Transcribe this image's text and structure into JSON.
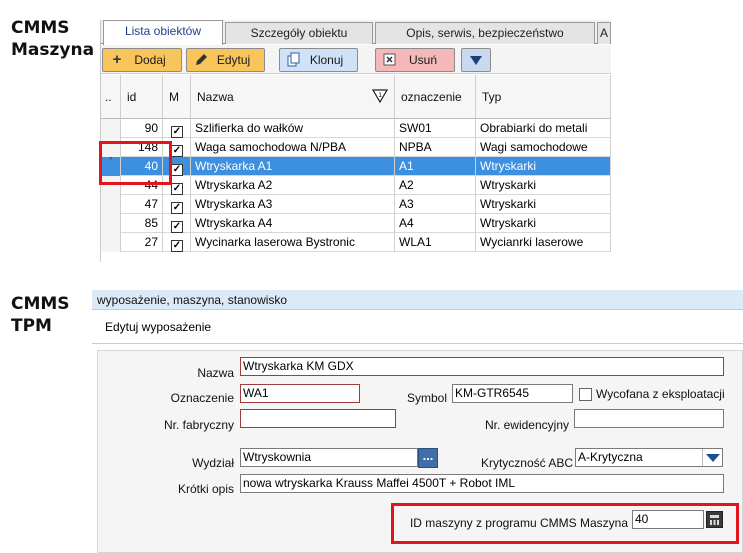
{
  "labels": {
    "cmms_line1": "CMMS",
    "cmms_line2": "Maszyna",
    "tpm_line1": "CMMS",
    "tpm_line2": "TPM"
  },
  "tabs": [
    {
      "label": "Lista obiektów",
      "active": true
    },
    {
      "label": "Szczegóły obiektu",
      "active": false
    },
    {
      "label": "Opis, serwis, bezpieczeństwo",
      "active": false
    },
    {
      "label": "A",
      "active": false
    }
  ],
  "toolbar": {
    "add_label": "Dodaj",
    "edit_label": "Edytuj",
    "clone_label": "Klonuj",
    "delete_label": "Usuń"
  },
  "grid": {
    "columns": [
      "..",
      "id",
      "M",
      "Nazwa",
      "oznaczenie",
      "Typ"
    ],
    "rows": [
      {
        "id": "90",
        "checked": true,
        "name": "Szlifierka do wałków",
        "code": "SW01",
        "type": "Obrabiarki do metali",
        "selected": false
      },
      {
        "id": "148",
        "checked": true,
        "name": "Waga samochodowa N/PBA",
        "code": "NPBA",
        "type": "Wagi samochodowe",
        "selected": false
      },
      {
        "id": "40",
        "checked": true,
        "name": "Wtryskarka A1",
        "code": "A1",
        "type": "Wtryskarki",
        "selected": true
      },
      {
        "id": "44",
        "checked": true,
        "name": "Wtryskarka A2",
        "code": "A2",
        "type": "Wtryskarki",
        "selected": false
      },
      {
        "id": "47",
        "checked": true,
        "name": "Wtryskarka A3",
        "code": "A3",
        "type": "Wtryskarki",
        "selected": false
      },
      {
        "id": "85",
        "checked": true,
        "name": "Wtryskarka A4",
        "code": "A4",
        "type": "Wtryskarki",
        "selected": false
      },
      {
        "id": "27",
        "checked": true,
        "name": "Wycinarka laserowa Bystronic",
        "code": "WLA1",
        "type": "Wycianrki laserowe",
        "selected": false
      }
    ]
  },
  "tpm": {
    "breadcrumb": "wyposażenie, maszyna, stanowisko",
    "title": "Edytuj wyposażenie",
    "fields": {
      "nazwa_label": "Nazwa",
      "nazwa_value": "Wtryskarka KM GDX",
      "oznaczenie_label": "Oznaczenie",
      "oznaczenie_value": "WA1",
      "symbol_label": "Symbol",
      "symbol_value": "KM-GTR6545",
      "wycofana_label": "Wycofana z eksploatacji",
      "fabryczny_label": "Nr. fabryczny",
      "fabryczny_value": "",
      "ewidencyjny_label": "Nr. ewidencyjny",
      "ewidencyjny_value": "",
      "wydzial_label": "Wydział",
      "wydzial_value": "Wtryskownia",
      "ellipsis": "...",
      "krytycznosc_label": "Krytyczność ABC",
      "krytycznosc_value": "A-Krytyczna",
      "opis_label": "Krótki opis",
      "opis_value": "nowa wtryskarka Krauss Maffei 4500T + Robot IML",
      "id_maszyny_label": "ID maszyny z programu CMMS Maszyna",
      "id_maszyny_value": "40"
    }
  },
  "colors": {
    "highlight_red": "#e3141c",
    "selected_row": "#3d8fe0",
    "toolbar_orange": "#f7c55a"
  }
}
